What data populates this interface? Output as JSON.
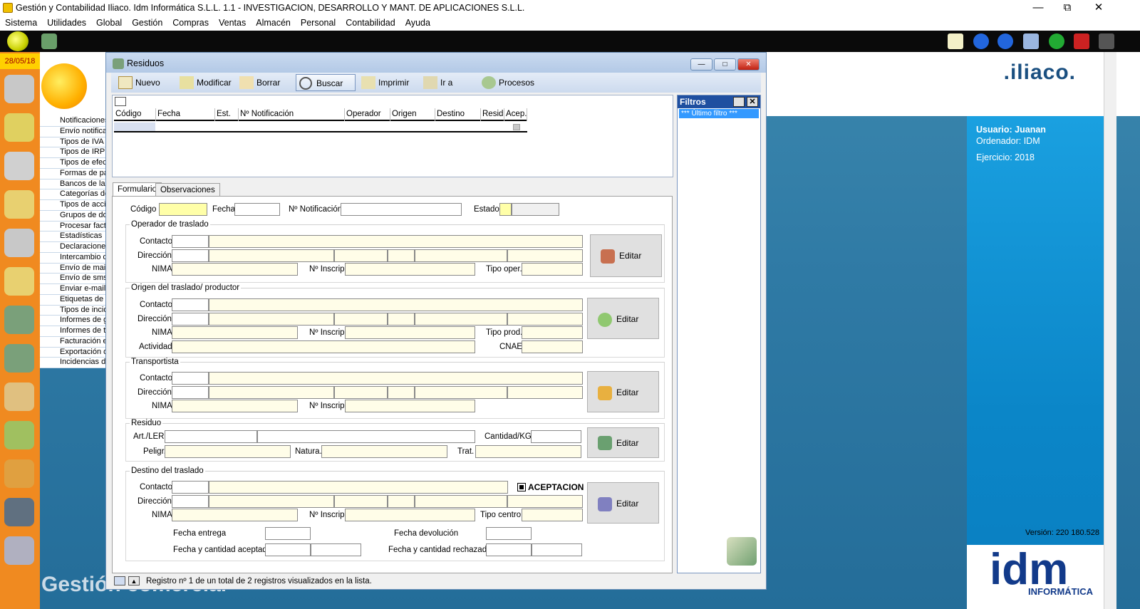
{
  "app": {
    "title": "Gestión y Contabilidad Iliaco. Idm Informática S.L.L. 1.1 - INVESTIGACION, DESARROLLO Y MANT. DE APLICACIONES S.L.L.",
    "menu": [
      "Sistema",
      "Utilidades",
      "Global",
      "Gestión",
      "Compras",
      "Ventas",
      "Almacén",
      "Personal",
      "Contabilidad",
      "Ayuda"
    ],
    "date": "28/05/18",
    "bg_menu_items": [
      "Notificaciones",
      "Envío notifica",
      "Tipos de IVA",
      "Tipos de IRPF",
      "Tipos de efec",
      "Formas de pa",
      "Bancos de la",
      "Categorías de",
      "Tipos de acci",
      "Grupos de do",
      "Procesar fact",
      "Estadísticas",
      "Declaraciones",
      "Intercambio d",
      "Envío de mail",
      "Envío de sms",
      "Enviar e-mail",
      "Etiquetas de e",
      "Tipos de incid",
      "Informes de g",
      "Informes de te",
      "Facturación e",
      "Exportación d",
      "Incidencias de"
    ],
    "bg_title": "Gestión comercial",
    "brand_text": ".iliaco.",
    "user_label": "Usuario: Juanan",
    "computer_label": "Ordenador: IDM",
    "year_label": "Ejercicio: 2018",
    "version": "Versión: 220 180.528",
    "idm_logo": "idm",
    "idm_sub": "INFORMÁTICA"
  },
  "window": {
    "title": "Residuos",
    "toolbar": [
      "Nuevo",
      "Modificar",
      "Borrar",
      "Buscar",
      "Imprimir",
      "Ir a",
      "Procesos"
    ],
    "grid_columns": [
      "Código",
      "Fecha",
      "Est.",
      "Nº Notificación",
      "Operador",
      "Origen",
      "Destino",
      "Residu",
      "Acep."
    ],
    "filters": {
      "title": "Filtros",
      "item": "*** Último filtro ***"
    },
    "tabs": [
      "Formulario",
      "Observaciones"
    ],
    "form": {
      "codigo": "Código",
      "fecha": "Fecha",
      "notificacion": "Nº Notificación",
      "estado": "Estado",
      "operador_title": "Operador de traslado",
      "origen_title": "Origen del traslado/ productor",
      "transportista_title": "Transportista",
      "residuo_title": "Residuo",
      "destino_title": "Destino del traslado",
      "contacto": "Contacto",
      "direccion": "Dirección",
      "nima": "NIMA",
      "inscrip": "Nº Inscrip.",
      "tipo_oper": "Tipo oper.",
      "tipo_prod": "Tipo prod.",
      "actividad": "Actividad",
      "cnae": "CNAE",
      "art_ler": "Art./LER",
      "cantidad": "Cantidad/KG",
      "pelig": "Peligr.",
      "natura": "Natura.",
      "trat": "Trat.",
      "aceptacion": "ACEPTACION",
      "tipo_centro": "Tipo centro.",
      "fecha_entrega": "Fecha entrega",
      "fecha_devolucion": "Fecha devolución",
      "fecha_cant_aceptada": "Fecha y cantidad aceptada",
      "fecha_cant_rechazada": "Fecha y cantidad rechazada",
      "editar": "Editar"
    },
    "status": "Registro nº 1 de un total de 2 registros visualizados en la lista."
  }
}
